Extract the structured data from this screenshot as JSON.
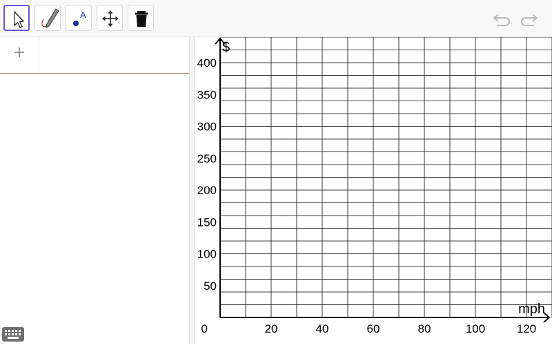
{
  "toolbar": {
    "tools": [
      {
        "name": "move-tool",
        "icon": "arrow-cursor-icon"
      },
      {
        "name": "pen-tool",
        "icon": "pen-icon"
      },
      {
        "name": "point-tool",
        "icon": "point-icon",
        "glyph": "A"
      },
      {
        "name": "move-view-tool",
        "icon": "four-way-arrow-icon"
      },
      {
        "name": "delete-tool",
        "icon": "trash-icon"
      }
    ],
    "undo_icon": "undo-icon",
    "redo_icon": "redo-icon",
    "accent_color": "#6557d2"
  },
  "algebra": {
    "add_symbol": "+"
  },
  "keyboard": {
    "icon": "keyboard-icon"
  },
  "graph": {
    "x_axis_label": "mph",
    "y_axis_label": "$",
    "origin_label": "0",
    "x_major_step": 20,
    "x_grid_step": 10,
    "y_major_step": 50,
    "y_grid_step": 25,
    "x_ticks": [
      {
        "value": 20,
        "label": "20"
      },
      {
        "value": 40,
        "label": "40"
      },
      {
        "value": 60,
        "label": "60"
      },
      {
        "value": 80,
        "label": "80"
      },
      {
        "value": 100,
        "label": "100"
      },
      {
        "value": 120,
        "label": "120"
      }
    ],
    "y_ticks": [
      {
        "value": 50,
        "label": "50"
      },
      {
        "value": 100,
        "label": "100"
      },
      {
        "value": 150,
        "label": "150"
      },
      {
        "value": 200,
        "label": "200"
      },
      {
        "value": 250,
        "label": "250"
      },
      {
        "value": 300,
        "label": "300"
      },
      {
        "value": 350,
        "label": "350"
      },
      {
        "value": 400,
        "label": "400"
      }
    ],
    "grid_color": "#000000"
  }
}
